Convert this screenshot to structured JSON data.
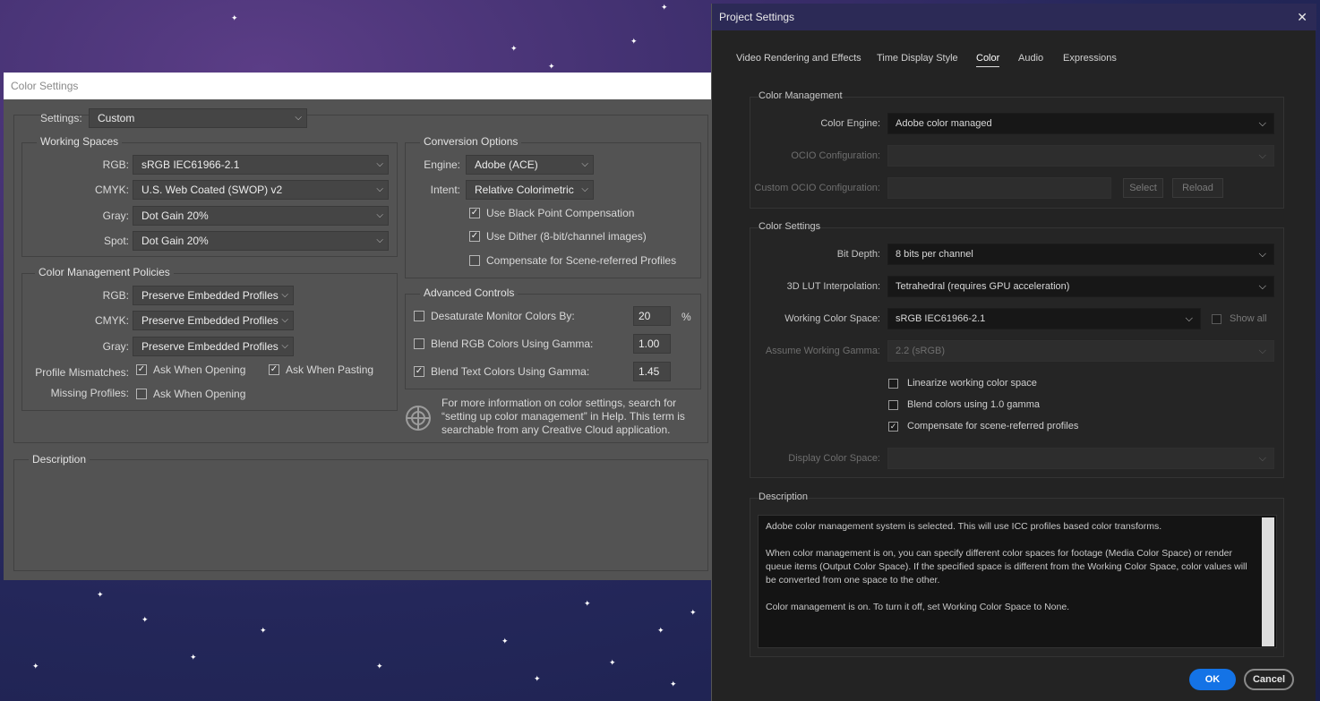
{
  "color_settings": {
    "window_title": "Color Settings",
    "settings_label": "Settings:",
    "settings_value": "Custom",
    "working_spaces": {
      "title": "Working Spaces",
      "rgb_label": "RGB:",
      "rgb_value": "sRGB IEC61966-2.1",
      "cmyk_label": "CMYK:",
      "cmyk_value": "U.S. Web Coated (SWOP) v2",
      "gray_label": "Gray:",
      "gray_value": "Dot Gain 20%",
      "spot_label": "Spot:",
      "spot_value": "Dot Gain 20%"
    },
    "policies": {
      "title": "Color Management Policies",
      "rgb_label": "RGB:",
      "rgb_value": "Preserve Embedded Profiles",
      "cmyk_label": "CMYK:",
      "cmyk_value": "Preserve Embedded Profiles",
      "gray_label": "Gray:",
      "gray_value": "Preserve Embedded Profiles",
      "mismatch_label": "Profile Mismatches:",
      "ask_opening": "Ask When Opening",
      "ask_pasting": "Ask When Pasting",
      "missing_label": "Missing Profiles:",
      "missing_ask": "Ask When Opening"
    },
    "conversion": {
      "title": "Conversion Options",
      "engine_label": "Engine:",
      "engine_value": "Adobe (ACE)",
      "intent_label": "Intent:",
      "intent_value": "Relative Colorimetric",
      "bpc": "Use Black Point Compensation",
      "dither": "Use Dither (8-bit/channel images)",
      "scene": "Compensate for Scene-referred Profiles"
    },
    "advanced": {
      "title": "Advanced Controls",
      "desaturate": "Desaturate Monitor Colors By:",
      "desaturate_value": "20",
      "percent": "%",
      "blend_rgb": "Blend RGB Colors Using Gamma:",
      "blend_rgb_value": "1.00",
      "blend_text": "Blend Text Colors Using Gamma:",
      "blend_text_value": "1.45"
    },
    "info": "For more information on color settings, search for “setting up color management” in Help. This term is searchable from any Creative Cloud application.",
    "description_title": "Description"
  },
  "project_settings": {
    "window_title": "Project Settings",
    "close_glyph": "✕",
    "tabs": [
      "Video Rendering and Effects",
      "Time Display Style",
      "Color",
      "Audio",
      "Expressions"
    ],
    "color_management": {
      "title": "Color Management",
      "engine_label": "Color Engine:",
      "engine_value": "Adobe color managed",
      "ocio_label": "OCIO Configuration:",
      "custom_ocio_label": "Custom OCIO Configuration:",
      "select": "Select",
      "reload": "Reload"
    },
    "color_settings": {
      "title": "Color Settings",
      "bit_depth_label": "Bit Depth:",
      "bit_depth_value": "8 bits per channel",
      "lut_label": "3D LUT Interpolation:",
      "lut_value": "Tetrahedral (requires GPU acceleration)",
      "wcs_label": "Working Color Space:",
      "wcs_value": "sRGB IEC61966-2.1",
      "show_all": "Show all",
      "gamma_label": "Assume Working Gamma:",
      "gamma_value": "2.2 (sRGB)",
      "linearize": "Linearize working color space",
      "blend10": "Blend colors using 1.0 gamma",
      "compensate": "Compensate for scene-referred profiles",
      "display_label": "Display Color Space:"
    },
    "description": {
      "title": "Description",
      "p1": "Adobe color management system is selected. This will use ICC profiles based color transforms.",
      "p2": "When color management is on, you can specify different color spaces for footage (Media Color Space) or render queue items (Output Color Space). If the specified space is different from the Working Color Space, color values will be converted from one space to the other.",
      "p3": "Color management is on. To turn it off, set Working Color Space to None."
    },
    "ok": "OK",
    "cancel": "Cancel"
  }
}
